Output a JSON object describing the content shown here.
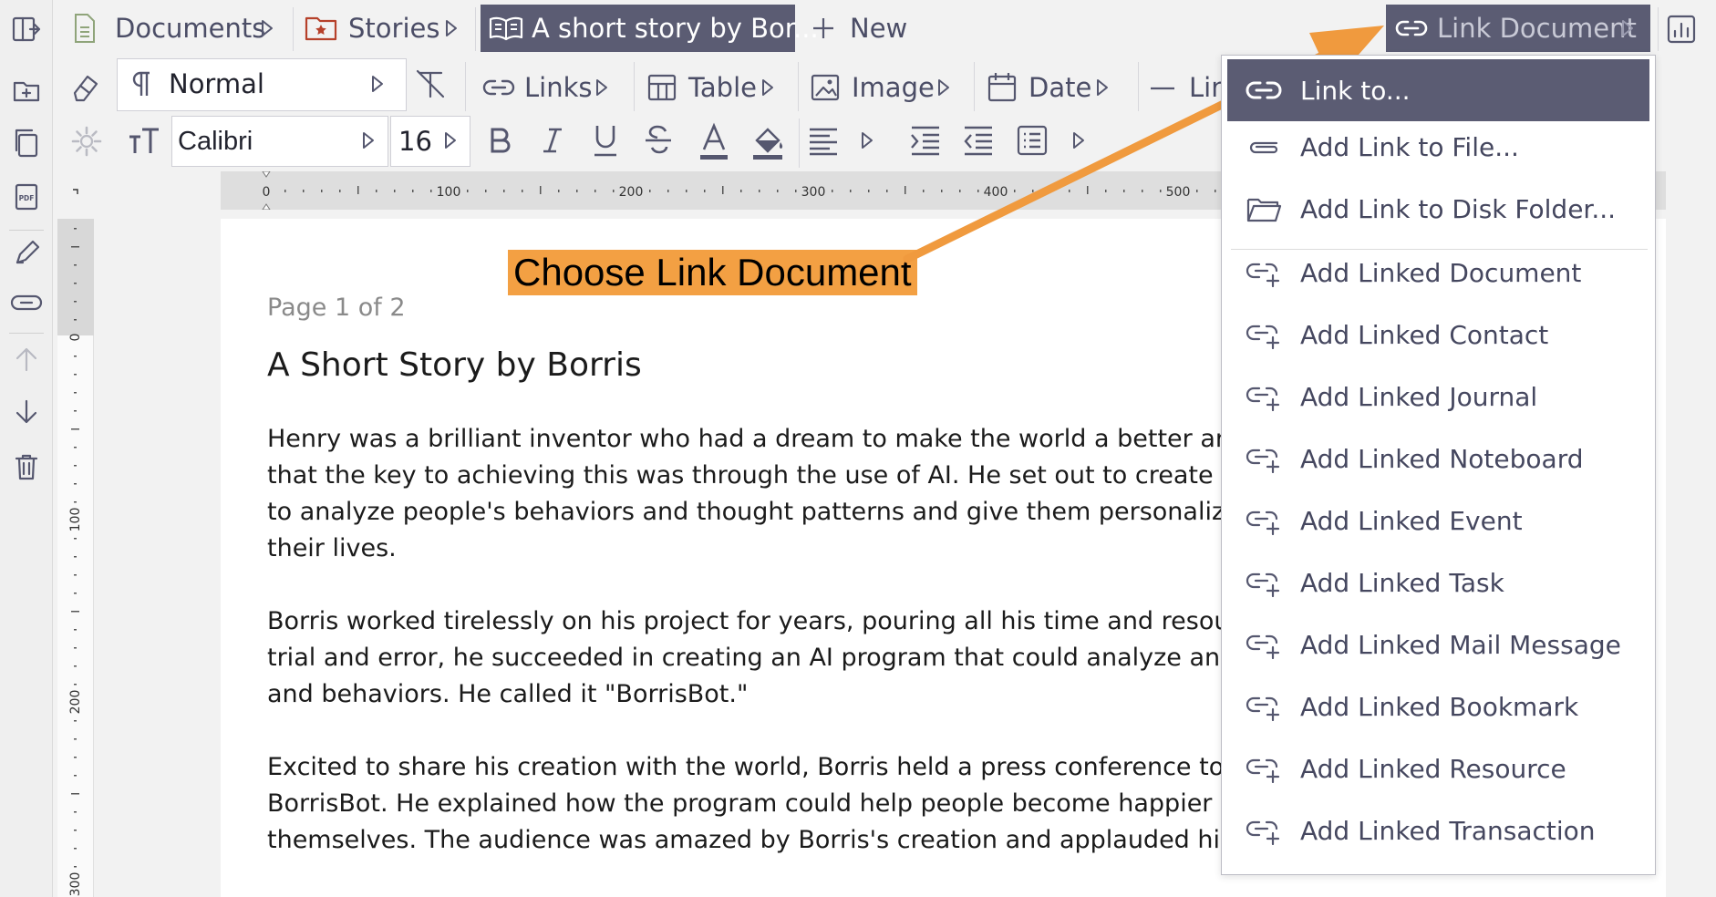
{
  "tabs": {
    "documents": "Documents",
    "stories": "Stories",
    "active": "A short story by Bor...",
    "new": "New",
    "link_document": "Link Document"
  },
  "toolbar": {
    "style": "Normal",
    "links": "Links",
    "table": "Table",
    "image": "Image",
    "date": "Date",
    "line": "Lin",
    "font": "Calibri",
    "size": "16"
  },
  "ruler": {
    "h_ticks": [
      "0",
      "100",
      "200",
      "300",
      "400",
      "500"
    ],
    "v_ticks": [
      "0",
      "100",
      "200",
      "300"
    ]
  },
  "document": {
    "page_label": "Page 1 of 2",
    "title": "A Short Story by Borris",
    "paragraphs": [
      [
        "Henry was a brilliant inventor who had a dream to make the world a better and h",
        "that the key to achieving this was through the use of AI. He set out to create an A",
        "to analyze people's behaviors and thought patterns and give them personalized a",
        "their lives."
      ],
      [
        "Borris worked tirelessly on his project for years, pouring all his time and resource",
        "trial and error, he succeeded in creating an AI program that could analyze and ur",
        "and behaviors. He called it \"BorrisBot.\""
      ],
      [
        "Excited to share his creation with the world, Borris held a press conference to an",
        "BorrisBot. He explained how the program could help people become happier and",
        "themselves. The audience was amazed by Borris's creation and applauded him fo"
      ]
    ]
  },
  "menu": {
    "items": [
      {
        "label": "Link to...",
        "icon": "link-icon"
      },
      {
        "label": "Add Link to File...",
        "icon": "paperclip-icon"
      },
      {
        "label": "Add Link to Disk Folder...",
        "icon": "folder-icon"
      },
      {
        "label": "Add Linked Document",
        "icon": "add-link-icon"
      },
      {
        "label": "Add Linked Contact",
        "icon": "add-link-icon"
      },
      {
        "label": "Add Linked Journal",
        "icon": "add-link-icon"
      },
      {
        "label": "Add Linked Noteboard",
        "icon": "add-link-icon"
      },
      {
        "label": "Add Linked Event",
        "icon": "add-link-icon"
      },
      {
        "label": "Add Linked Task",
        "icon": "add-link-icon"
      },
      {
        "label": "Add Linked Mail Message",
        "icon": "add-link-icon"
      },
      {
        "label": "Add Linked Bookmark",
        "icon": "add-link-icon"
      },
      {
        "label": "Add Linked Resource",
        "icon": "add-link-icon"
      },
      {
        "label": "Add Linked Transaction",
        "icon": "add-link-icon"
      }
    ]
  },
  "annotation": {
    "text": "Choose Link Document",
    "color": "#f3a043"
  },
  "colors": {
    "accent": "#5b5c73",
    "arrow": "#f09a3e"
  }
}
